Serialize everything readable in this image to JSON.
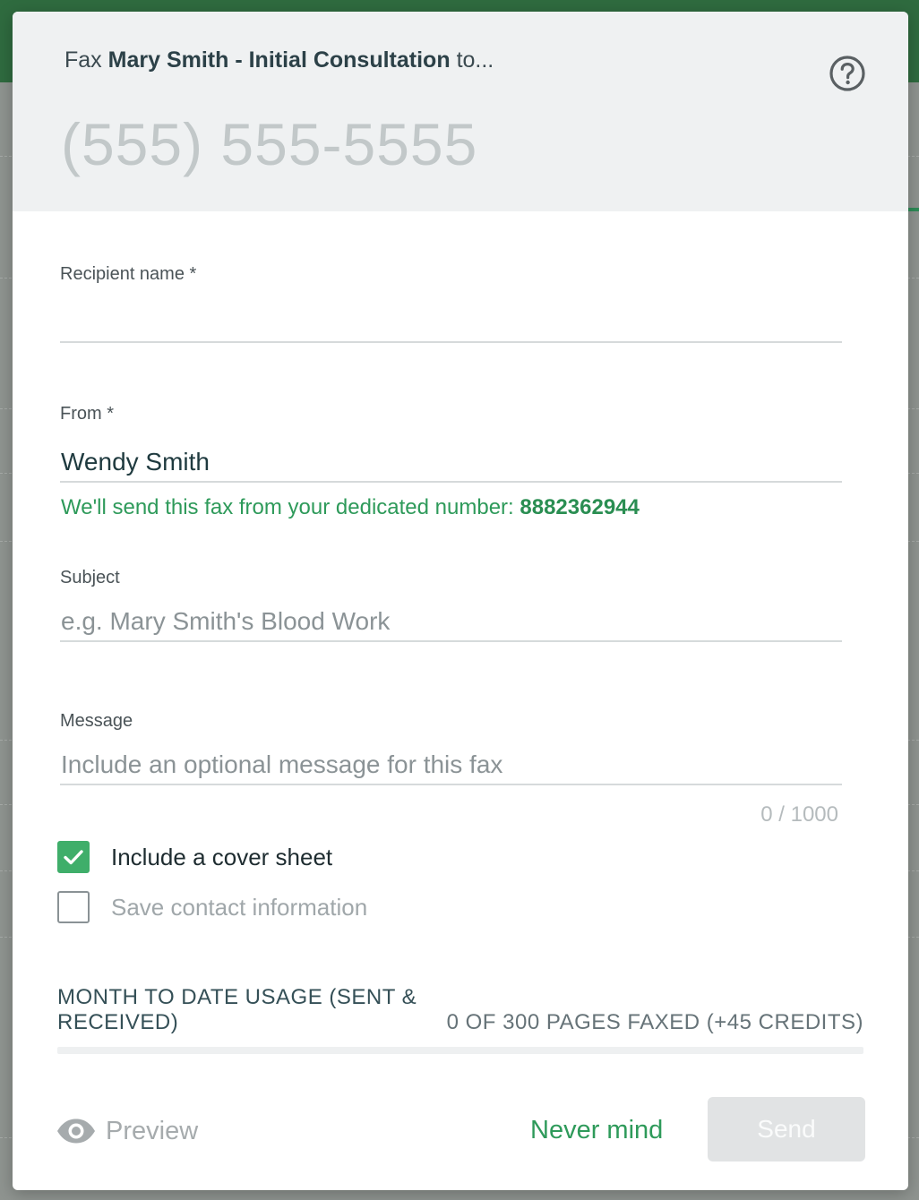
{
  "header": {
    "title_prefix": "Fax",
    "title_document": "Mary Smith - Initial Consultation",
    "title_suffix": "to...",
    "fax_number_placeholder": "(555) 555-5555",
    "help_icon": "question-circle-icon"
  },
  "form": {
    "recipient": {
      "label": "Recipient name",
      "required_mark": "*",
      "value": ""
    },
    "from": {
      "label": "From",
      "required_mark": "*",
      "value": "Wendy Smith"
    },
    "dedicated_hint": "We'll send this fax from your dedicated number:",
    "dedicated_number": "8882362944",
    "subject": {
      "label": "Subject",
      "placeholder": "e.g. Mary Smith's Blood Work"
    },
    "message": {
      "label": "Message",
      "placeholder": "Include an optional message for this fax",
      "counter": "0 / 1000"
    },
    "cover_sheet": {
      "label": "Include a cover sheet",
      "checked": true
    },
    "save_contact": {
      "label": "Save contact information",
      "checked": false
    }
  },
  "usage": {
    "label": "MONTH TO DATE USAGE (SENT & RECEIVED)",
    "value": "0 OF 300 PAGES FAXED (+45 CREDITS)",
    "progress_fraction": 0
  },
  "footer": {
    "preview_label": "Preview",
    "preview_icon": "eye-icon",
    "nevermind_label": "Never mind",
    "send_label": "Send"
  },
  "colors": {
    "accent_green": "#2e9a5a",
    "checkbox_green": "#3fae6a",
    "header_bg": "#eff1f2"
  }
}
